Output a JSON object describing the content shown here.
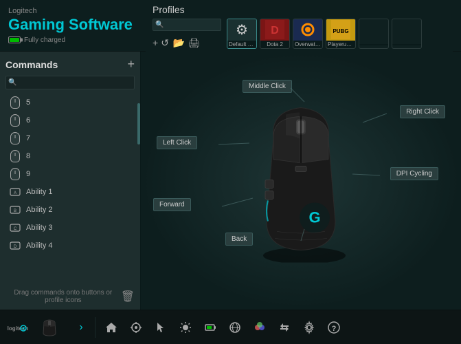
{
  "app": {
    "vendor": "Logitech",
    "title": "Gaming Software",
    "battery_status": "Fully charged"
  },
  "profiles": {
    "title": "Profiles",
    "search_placeholder": "Search",
    "items": [
      {
        "id": "default",
        "label": "Default Profi",
        "color": "#1a3030",
        "icon": "⚙"
      },
      {
        "id": "dota2",
        "label": "Dota 2",
        "color": "#8b1a1a",
        "icon": "🎮"
      },
      {
        "id": "overwatch",
        "label": "Overwatch",
        "color": "#1a3050",
        "icon": "⊕"
      },
      {
        "id": "pubg",
        "label": "Playerunkno...",
        "color": "#c49a10",
        "icon": "🎯"
      },
      {
        "id": "empty1",
        "label": "",
        "color": "#0f2020",
        "icon": ""
      },
      {
        "id": "empty2",
        "label": "",
        "color": "#0f2020",
        "icon": ""
      }
    ],
    "actions": [
      "+",
      "↺",
      "📁",
      "🖨"
    ]
  },
  "commands": {
    "title": "Commands",
    "add_label": "+",
    "search_placeholder": "Search",
    "footer_text": "Drag commands onto buttons or profile icons",
    "items": [
      {
        "label": "5",
        "type": "mouse"
      },
      {
        "label": "6",
        "type": "mouse"
      },
      {
        "label": "7",
        "type": "mouse"
      },
      {
        "label": "8",
        "type": "mouse"
      },
      {
        "label": "9",
        "type": "mouse"
      },
      {
        "label": "Ability 1",
        "type": "key"
      },
      {
        "label": "Ability 2",
        "type": "key"
      },
      {
        "label": "Ability 3",
        "type": "key"
      },
      {
        "label": "Ability 4",
        "type": "key"
      }
    ]
  },
  "mouse_callouts": {
    "middle_click": "Middle Click",
    "right_click": "Right Click",
    "left_click": "Left Click",
    "dpi_cycling": "DPI Cycling",
    "forward": "Forward",
    "back": "Back"
  },
  "toolbar": {
    "logo_text": "logitech",
    "nav_arrow": "›",
    "icons": [
      "🏠",
      "✦",
      "◎",
      "💡",
      "🔋",
      "🌐",
      "🌈",
      "⚡",
      "⚙",
      "?"
    ]
  }
}
